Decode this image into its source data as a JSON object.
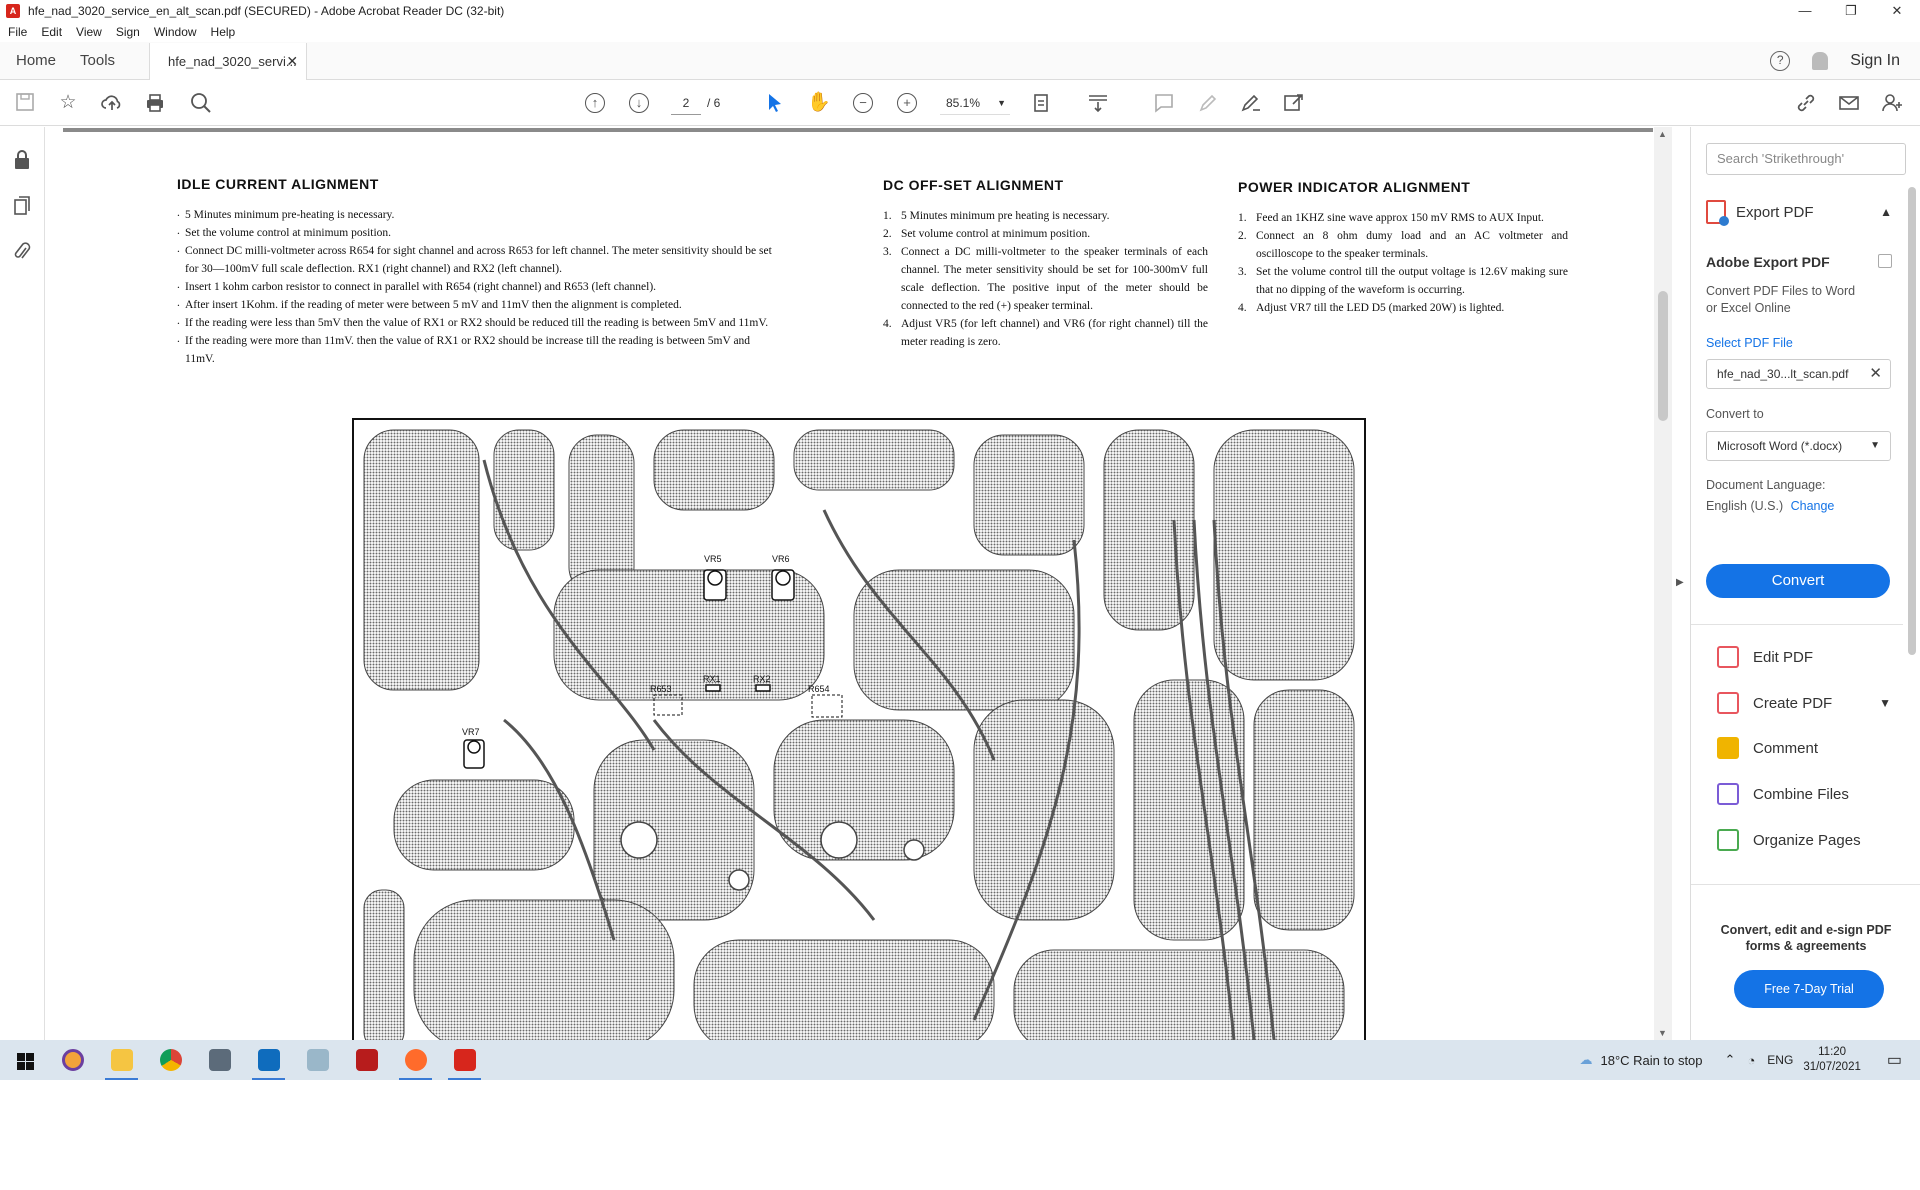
{
  "window": {
    "title": "hfe_nad_3020_service_en_alt_scan.pdf (SECURED) - Adobe Acrobat Reader DC (32-bit)",
    "controls": [
      "—",
      "❐",
      "✕"
    ]
  },
  "menu": [
    "File",
    "Edit",
    "View",
    "Sign",
    "Window",
    "Help"
  ],
  "tabs": {
    "home": "Home",
    "tools": "Tools",
    "doc": "hfe_nad_3020_servi...",
    "close": "✕",
    "help": "?",
    "signin": "Sign In"
  },
  "toolbar": {
    "page_current": "2",
    "page_total": "/ 6",
    "zoom": "85.1%",
    "zoom_arrow": "▼"
  },
  "doc": {
    "idle": {
      "title": "IDLE CURRENT ALIGNMENT",
      "items": [
        "5 Minutes minimum pre-heating is necessary.",
        "Set the volume control at minimum position.",
        "Connect DC milli-voltmeter across R654 for sight channel and across R653 for left channel. The meter sensitivity should be set for 30—100mV full scale deflection.  RX1 (right channel) and RX2 (left channel).",
        "Insert 1 kohm carbon resistor to connect in parallel with R654 (right channel) and R653 (left channel).",
        "After insert 1Kohm. if the reading of meter were between 5 mV and 11mV then the alignment is completed.",
        "If the reading were less than 5mV then the value of RX1 or RX2 should be reduced till the reading is between 5mV and 11mV.",
        "If the reading were more than 11mV. then the value of RX1 or RX2 should be increase till the reading is between 5mV and 11mV."
      ]
    },
    "dc": {
      "title": "DC OFF-SET  ALIGNMENT",
      "items": [
        {
          "n": "1.",
          "t": "5 Minutes minimum pre heating is necessary."
        },
        {
          "n": "2.",
          "t": "Set volume control at minimum position."
        },
        {
          "n": "3.",
          "t": "Connect a DC milli-voltmeter to the speaker terminals of each channel.  The meter sensitivity should be set for 100-300mV full scale deflection.  The positive input of the meter should be connected to the red (+) speaker terminal."
        },
        {
          "n": "4.",
          "t": "Adjust VR5 (for left channel) and VR6 (for right channel) till the meter reading is zero."
        }
      ]
    },
    "power": {
      "title": "POWER INDICATOR ALIGNMENT",
      "items": [
        {
          "n": "1.",
          "t": "Feed an 1KHZ sine wave approx 150 mV RMS to AUX Input."
        },
        {
          "n": "2.",
          "t": "Connect an 8 ohm dumy load and an AC voltmeter and oscilloscope to the speaker terminals."
        },
        {
          "n": "3.",
          "t": "Set the volume control till the output voltage is 12.6V making sure that no dipping of the waveform is occurring."
        },
        {
          "n": "4.",
          "t": "Adjust VR7 till the LED D5 (marked 20W) is lighted."
        }
      ]
    },
    "pcb_labels": {
      "vr5": "VR5",
      "vr6": "VR6",
      "rx1": "RX1",
      "rx2": "RX2",
      "r653": "R653",
      "r654": "R654",
      "vr7": "VR7"
    }
  },
  "panel": {
    "search_placeholder": "Search 'Strikethrough'",
    "export_title": "Export PDF",
    "section_title": "Adobe Export PDF",
    "desc": "Convert PDF Files to Word or Excel Online",
    "select_file_link": "Select PDF File",
    "file_name": "hfe_nad_30...lt_scan.pdf",
    "convert_to_label": "Convert to",
    "format": "Microsoft Word (*.docx)",
    "doc_lang_label": "Document Language:",
    "doc_lang_value": "English (U.S.)",
    "change_link": "Change",
    "convert_button": "Convert",
    "tools": [
      {
        "label": "Edit PDF",
        "color": "#e8565e"
      },
      {
        "label": "Create PDF",
        "color": "#e8565e"
      },
      {
        "label": "Comment",
        "color": "#f0b400"
      },
      {
        "label": "Combine Files",
        "color": "#7b5cd6"
      },
      {
        "label": "Organize Pages",
        "color": "#4aaa50"
      }
    ],
    "promo": "Convert, edit and e-sign PDF forms & agreements",
    "trial_button": "Free 7-Day Trial"
  },
  "taskbar": {
    "weather": "18°C  Rain to stop",
    "lang": "ENG",
    "time": "11:20",
    "date": "31/07/2021"
  },
  "colors": {
    "accent": "#1473e6",
    "taskbar": "#dbe5ee",
    "acrobat_red": "#d7261c"
  }
}
